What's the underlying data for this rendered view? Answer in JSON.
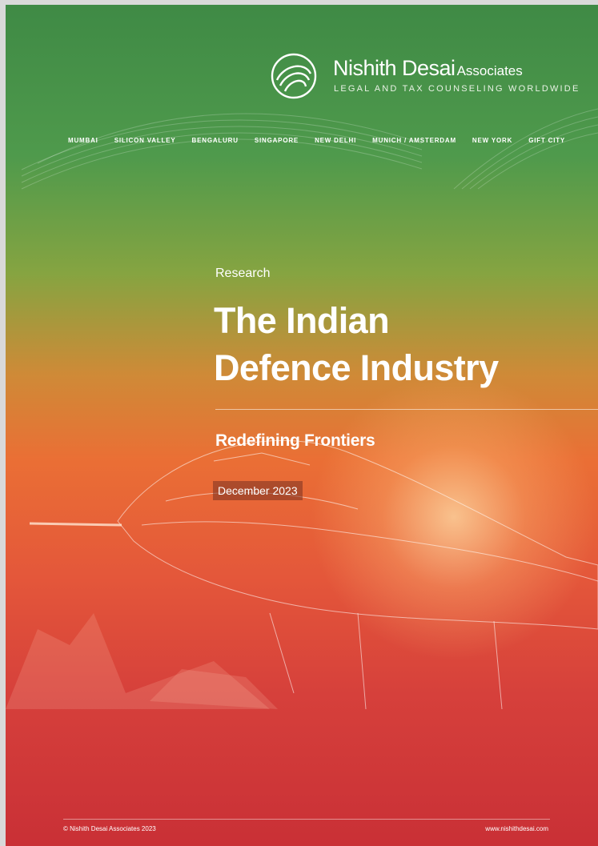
{
  "brand": {
    "name": "Nishith Desai",
    "suffix": "Associates",
    "tagline": "LEGAL AND TAX COUNSELING WORLDWIDE"
  },
  "cities": [
    "MUMBAI",
    "SILICON VALLEY",
    "BENGALURU",
    "SINGAPORE",
    "NEW DELHI",
    "MUNICH / AMSTERDAM",
    "NEW YORK",
    "GIFT CITY"
  ],
  "cover": {
    "label": "Research",
    "title_line1": "The Indian",
    "title_line2": "Defence Industry",
    "subtitle": "Redefining Frontiers",
    "date": "December 2023"
  },
  "footer": {
    "copyright": "© Nishith Desai Associates 2023",
    "url": "www.nishithdesai.com"
  },
  "colors": {
    "top_green": "#3f8a45",
    "mid_orange": "#ea6f35",
    "bottom_red": "#c93036"
  }
}
